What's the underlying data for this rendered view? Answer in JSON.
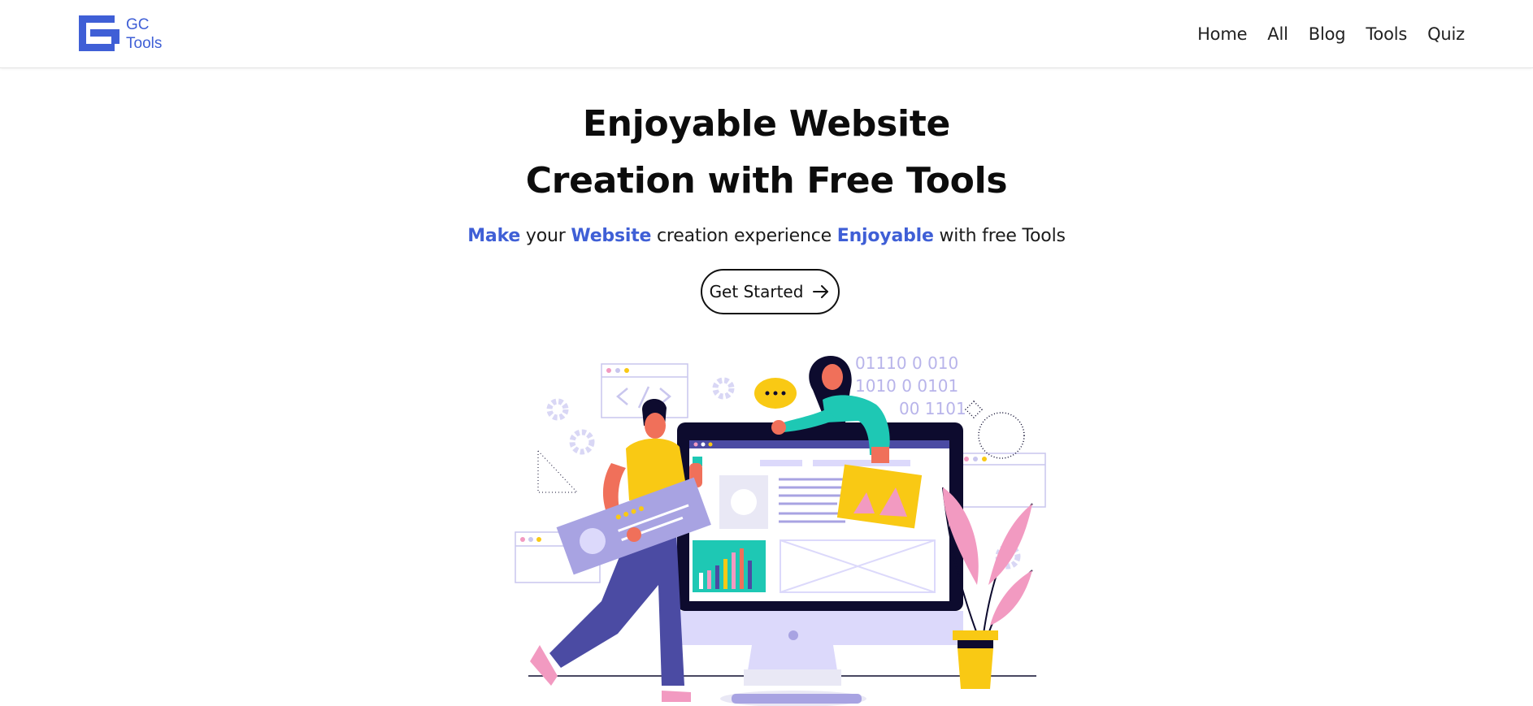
{
  "brand": {
    "line1": "GC",
    "line2": "Tools",
    "color": "#3f5fd6"
  },
  "nav": {
    "items": [
      "Home",
      "All",
      "Blog",
      "Tools",
      "Quiz"
    ]
  },
  "hero": {
    "title_line1": "Enjoyable Website",
    "title_line2": "Creation with Free Tools",
    "subtitle": {
      "w1": "Make",
      "t1": " your ",
      "w2": "Website",
      "t2": " creation experience ",
      "w3": "Enjoyable",
      "t3": " with free Tools"
    },
    "cta_label": "Get Started",
    "cta_icon": "arrow-right-icon"
  },
  "illustration": {
    "binary": [
      "01110 0 010",
      "1010 0 0101",
      "00 1101"
    ],
    "colors": {
      "accent_purple": "#4b4ba3",
      "yellow": "#f9c914",
      "teal": "#1ec8b4",
      "pink": "#f29ac1",
      "orange": "#f0705a",
      "navy": "#0d0b2e"
    }
  }
}
